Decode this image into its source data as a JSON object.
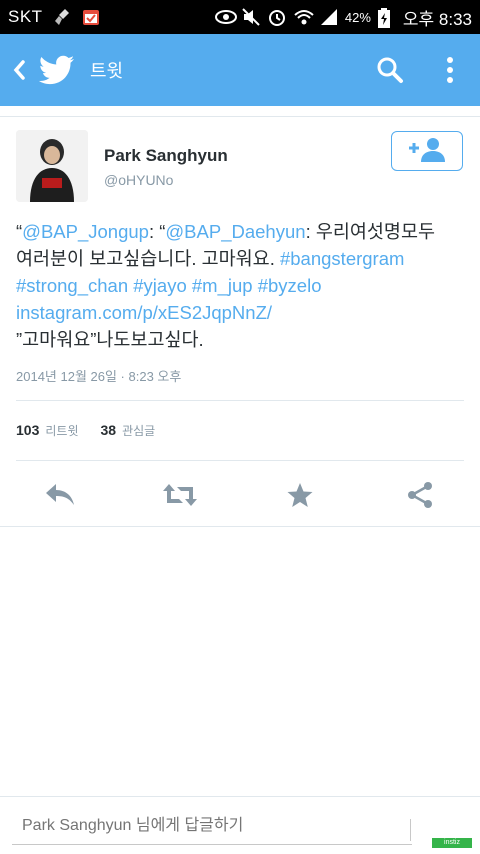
{
  "status_bar": {
    "carrier": "SKT",
    "battery_percent": "42%",
    "time": "오후 8:33",
    "icons": [
      "broom-icon",
      "calendar-check-icon",
      "eye-icon",
      "mute-icon",
      "alarm-icon",
      "wifi-icon",
      "signal-icon",
      "battery-charging-icon"
    ]
  },
  "app_bar": {
    "title": "트윗",
    "back_icon": "chevron-left-icon",
    "logo_icon": "twitter-bird-icon",
    "actions": [
      "search-icon",
      "overflow-menu-icon"
    ],
    "color": "#55acee"
  },
  "tweet": {
    "author_name": "Park Sanghyun",
    "author_handle": "@oHYUNo",
    "follow_icon": "add-user-icon",
    "text_lines": [
      [
        {
          "t": "“",
          "link": false
        },
        {
          "t": "@BAP_Jongup",
          "link": true
        },
        {
          "t": ": “",
          "link": false
        },
        {
          "t": "@BAP_Daehyun",
          "link": true
        },
        {
          "t": ": 우리여섯명모두",
          "link": false
        }
      ],
      [
        {
          "t": "여러분이 보고싶습니다. 고마워요. ",
          "link": false
        },
        {
          "t": "#bangstergram",
          "link": true
        }
      ],
      [
        {
          "t": "#strong_chan",
          "link": true
        },
        {
          "t": " ",
          "link": false
        },
        {
          "t": "#yjayo",
          "link": true
        },
        {
          "t": " ",
          "link": false
        },
        {
          "t": "#m_jup",
          "link": true
        },
        {
          "t": " ",
          "link": false
        },
        {
          "t": "#byzelo",
          "link": true
        }
      ],
      [
        {
          "t": "instagram.com/p/xES2JqpNnZ/",
          "link": true
        }
      ],
      [
        {
          "t": "”고마워요”나도보고싶다.",
          "link": false
        }
      ]
    ],
    "timestamp": "2014년 12월 26일 · 8:23 오후",
    "retweets_count": "103",
    "retweets_label": "리트윗",
    "favorites_count": "38",
    "favorites_label": "관심글",
    "action_icons": [
      "reply-icon",
      "retweet-icon",
      "favorite-star-icon",
      "share-icon"
    ],
    "link_color": "#55acee"
  },
  "reply": {
    "placeholder": "Park Sanghyun 님에게 답글하기"
  },
  "watermark": "instiz"
}
